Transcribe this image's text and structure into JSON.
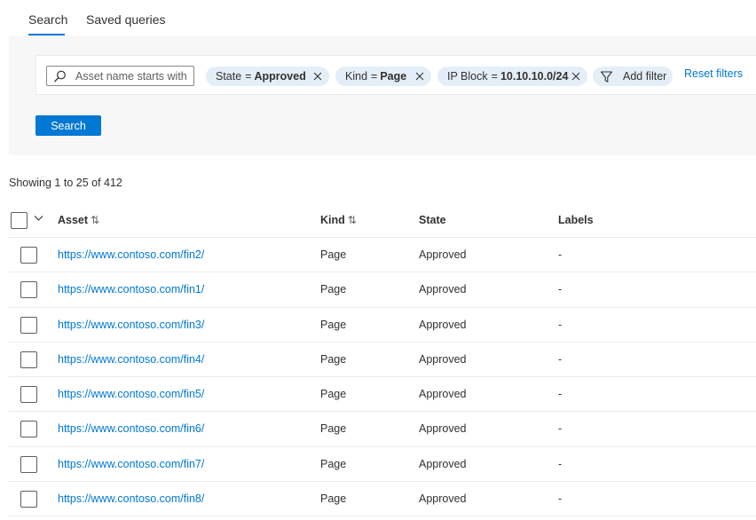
{
  "tabs": [
    {
      "label": "Search",
      "active": true
    },
    {
      "label": "Saved queries",
      "active": false
    }
  ],
  "filters": {
    "search_placeholder": "Asset name starts with",
    "pills": [
      {
        "key": "State",
        "op": "=",
        "value": "Approved"
      },
      {
        "key": "Kind",
        "op": "=",
        "value": "Page"
      },
      {
        "key": "IP Block",
        "op": "=",
        "value": "10.10.10.0/24"
      }
    ],
    "add_filter_label": "Add filter",
    "reset_label": "Reset filters"
  },
  "search_button_label": "Search",
  "showing_text": "Showing 1 to 25 of 412",
  "table": {
    "columns": {
      "asset": "Asset",
      "kind": "Kind",
      "state": "State",
      "labels": "Labels"
    },
    "sort_glyph": "⇅",
    "rows": [
      {
        "asset": "https://www.contoso.com/fin2/",
        "kind": "Page",
        "state": "Approved",
        "labels": "-"
      },
      {
        "asset": "https://www.contoso.com/fin1/",
        "kind": "Page",
        "state": "Approved",
        "labels": "-"
      },
      {
        "asset": "https://www.contoso.com/fin3/",
        "kind": "Page",
        "state": "Approved",
        "labels": "-"
      },
      {
        "asset": "https://www.contoso.com/fin4/",
        "kind": "Page",
        "state": "Approved",
        "labels": "-"
      },
      {
        "asset": "https://www.contoso.com/fin5/",
        "kind": "Page",
        "state": "Approved",
        "labels": "-"
      },
      {
        "asset": "https://www.contoso.com/fin6/",
        "kind": "Page",
        "state": "Approved",
        "labels": "-"
      },
      {
        "asset": "https://www.contoso.com/fin7/",
        "kind": "Page",
        "state": "Approved",
        "labels": "-"
      },
      {
        "asset": "https://www.contoso.com/fin8/",
        "kind": "Page",
        "state": "Approved",
        "labels": "-"
      }
    ]
  },
  "colors": {
    "accent": "#0078d4",
    "pill_background": "#e4eef8",
    "panel_background": "#f7f7f7"
  },
  "icons": [
    "search-icon",
    "close-icon",
    "filter-icon",
    "chevron-down-icon",
    "sort-icon",
    "checkbox-icon"
  ]
}
